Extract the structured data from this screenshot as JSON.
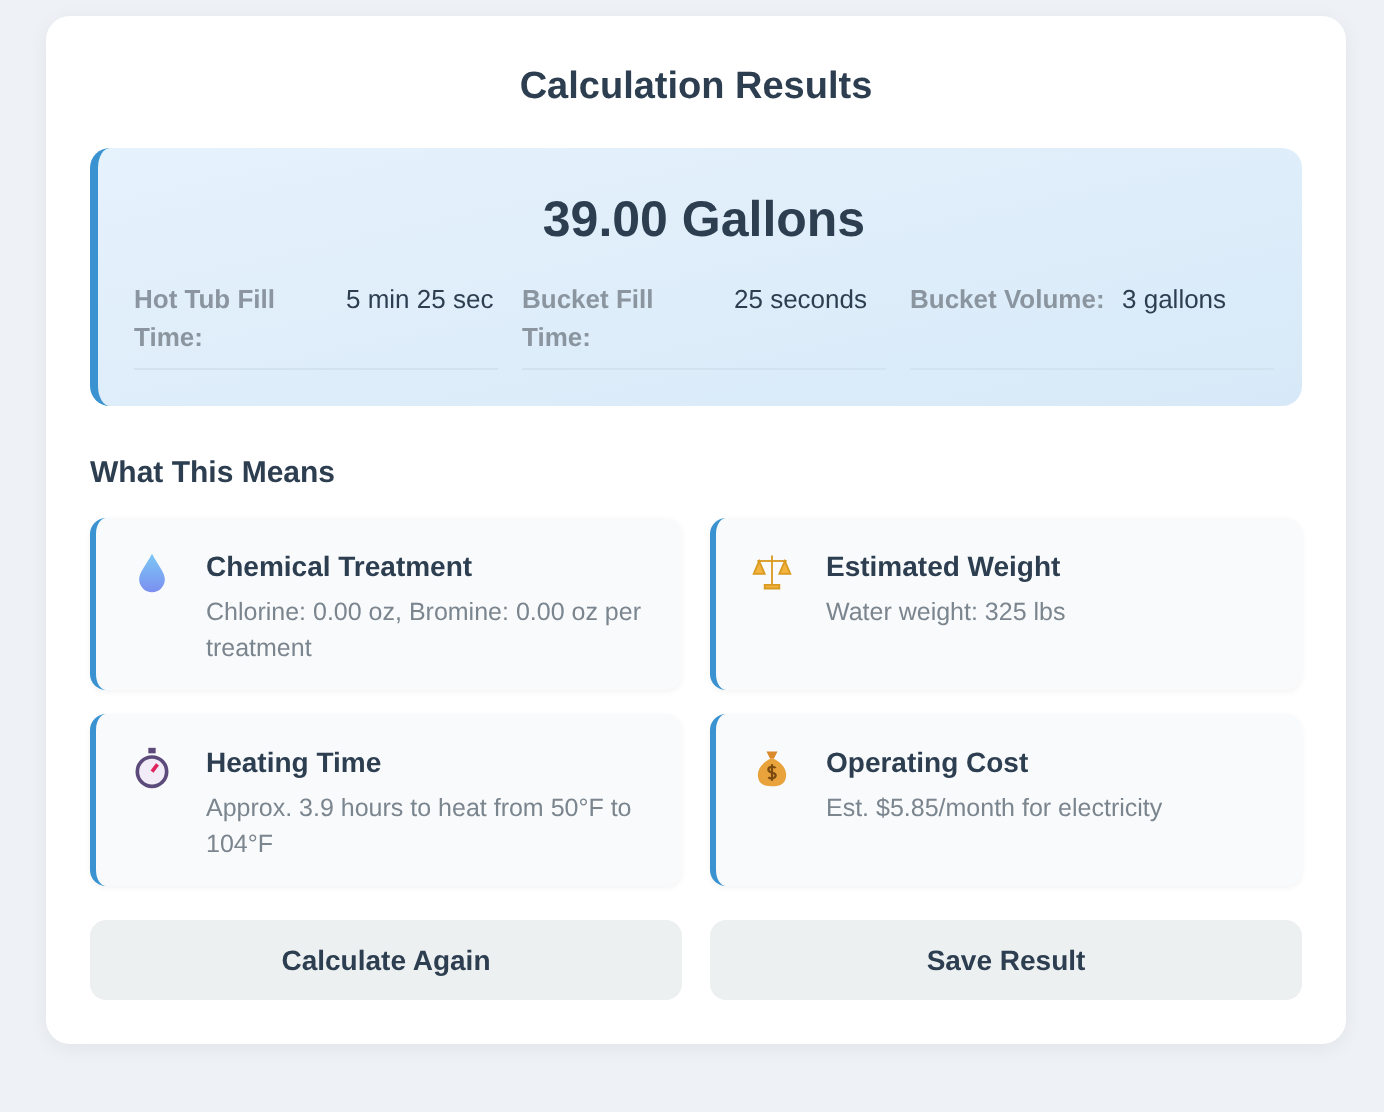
{
  "title": "Calculation Results",
  "result": {
    "amount": "39.00 Gallons",
    "stats": [
      {
        "label": "Hot Tub Fill Time:",
        "value": "5 min 25 sec"
      },
      {
        "label": "Bucket Fill Time:",
        "value": "25 seconds"
      },
      {
        "label": "Bucket Volume:",
        "value": "3 gallons"
      }
    ]
  },
  "section_title": "What This Means",
  "cards": [
    {
      "kind": "drop",
      "title": "Chemical Treatment",
      "text": "Chlorine: 0.00 oz, Bromine: 0.00 oz per treatment"
    },
    {
      "kind": "scale",
      "title": "Estimated Weight",
      "text": "Water weight: 325 lbs"
    },
    {
      "kind": "stopwatch",
      "title": "Heating Time",
      "text": "Approx. 3.9 hours to heat from 50°F to 104°F"
    },
    {
      "kind": "moneybag",
      "title": "Operating Cost",
      "text": "Est. $5.85/month for electricity"
    }
  ],
  "buttons": [
    "Calculate Again",
    "Save Result"
  ]
}
